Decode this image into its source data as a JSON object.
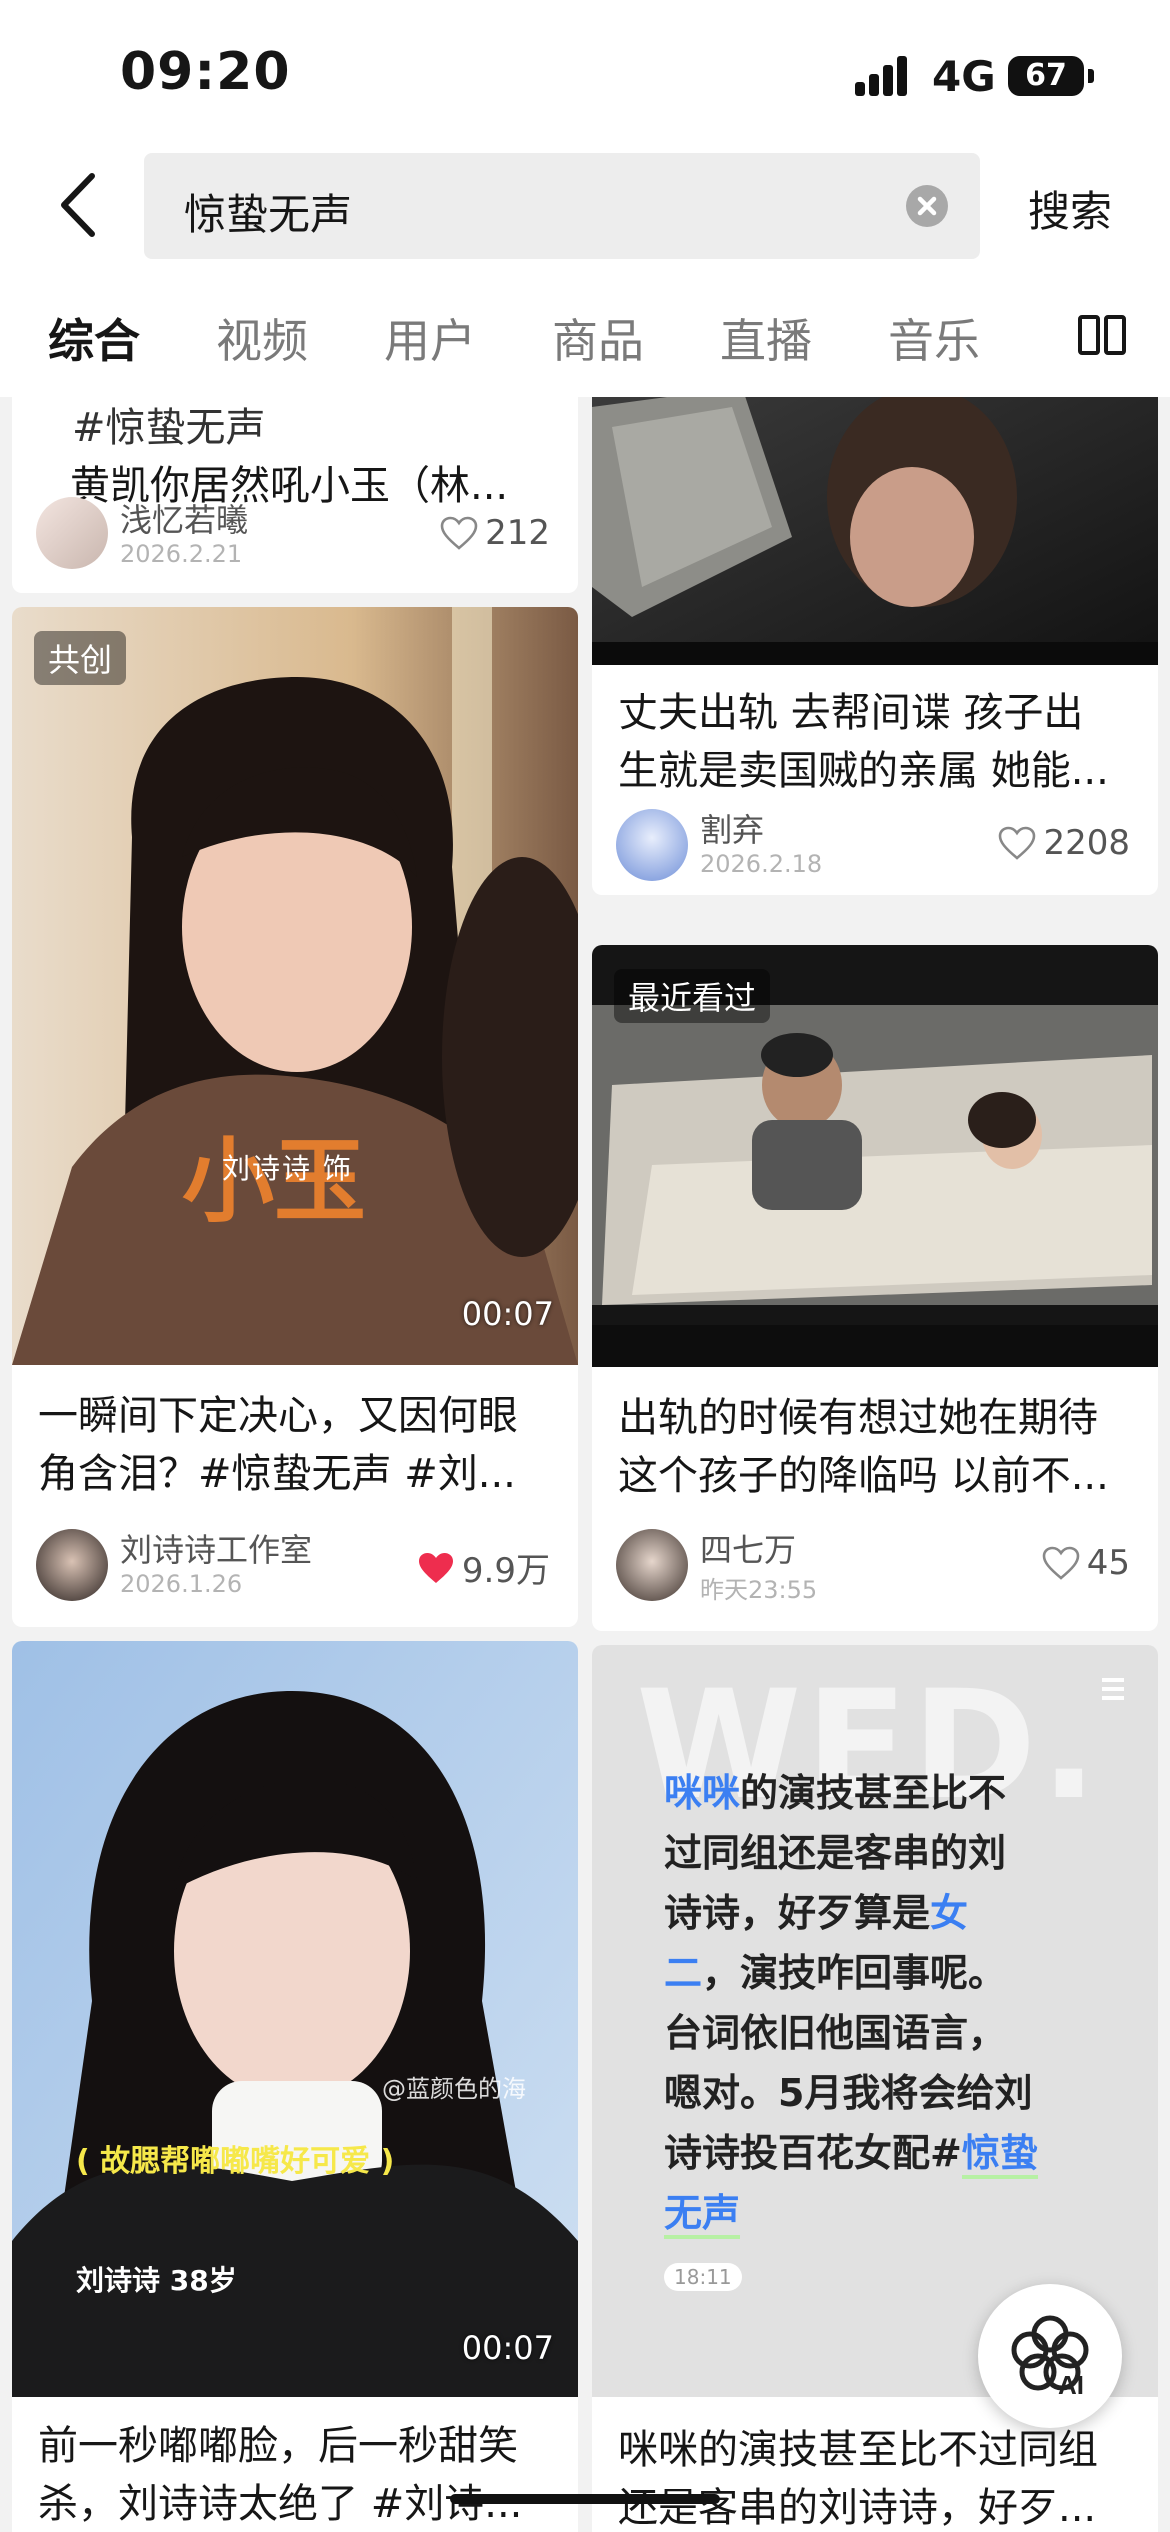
{
  "status_bar": {
    "time": "09:20",
    "network": "4G",
    "battery": "67"
  },
  "search": {
    "query": "惊蛰无声",
    "submit_label": "搜索"
  },
  "tabs": [
    {
      "label": "综合",
      "active": true
    },
    {
      "label": "视频",
      "active": false
    },
    {
      "label": "用户",
      "active": false
    },
    {
      "label": "商品",
      "active": false
    },
    {
      "label": "直播",
      "active": false
    },
    {
      "label": "音乐",
      "active": false
    }
  ],
  "cards": [
    {
      "title_lines": [
        "#惊蛰无声",
        "黄凯你居然吼小玉（林..."
      ],
      "author": "浅忆若曦",
      "date": "2026.2.21",
      "likes": "212",
      "liked": false
    },
    {
      "title_lines": [
        "丈夫出轨 去帮间谍 孩子出",
        "生就是卖国贼的亲属 她能..."
      ],
      "author": "割弃",
      "date": "2026.2.18",
      "likes": "2208",
      "liked": false
    },
    {
      "badge": "共创",
      "overlay_main": "小玉",
      "overlay_sub": "刘诗诗 饰",
      "duration": "00:07",
      "title_lines": [
        "一瞬间下定决心，又因何眼",
        "角含泪？#惊蛰无声 #刘..."
      ],
      "author": "刘诗诗工作室",
      "date": "2026.1.26",
      "likes": "9.9万",
      "liked": true
    },
    {
      "badge": "最近看过",
      "title_lines": [
        "出轨的时候有想过她在期待",
        "这个孩子的降临吗 以前不..."
      ],
      "author": "四七万",
      "date": "昨天23:55",
      "likes": "45",
      "liked": false
    },
    {
      "overlay_caption": "( 故腮帮嘟嘟嘴好可爱 )",
      "overlay_name": "刘诗诗 38岁",
      "watermark": "@蓝颜色的海",
      "duration": "00:07",
      "title_lines": [
        "前一秒嘟嘟脸，后一秒甜笑",
        "杀，刘诗诗太绝了 #刘诗..."
      ]
    },
    {
      "note_bg_text": "WED.",
      "note_time": "18:11",
      "title_lines": [
        "咪咪的演技甚至比不过同组",
        "还是客串的刘诗诗，好歹..."
      ]
    }
  ],
  "note_text": {
    "l1a": "咪咪",
    "l1b": "的演技甚至比不",
    "l2": "过同组还是客串的刘",
    "l3a": "诗诗，好歹算是",
    "l3b": "女",
    "l4a": "二",
    "l4b": "，演技咋回事呢。",
    "l5": "台词依旧他国语言，",
    "l6": "嗯对。5月我将会给刘",
    "l7a": "诗诗投百花女配#",
    "l7b": "惊蛰",
    "l8": "无声"
  },
  "ai_button": {
    "label": "AI"
  },
  "colors": {
    "accent_blue": "#3b7ff2",
    "heart_red": "#ee2d4e",
    "highlight_green": "#b7f0a4"
  }
}
